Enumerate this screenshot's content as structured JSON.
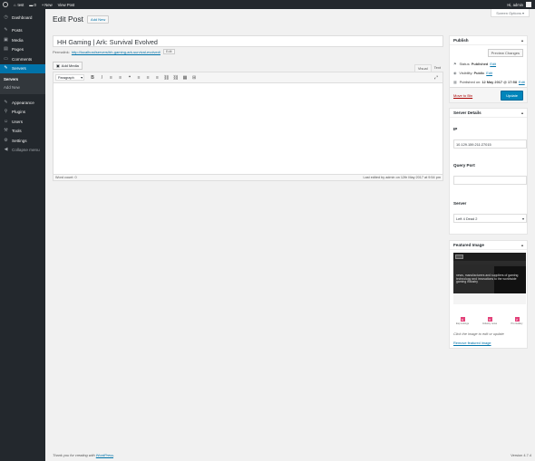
{
  "adminbar": {
    "site_name": "test",
    "comments_count": "0",
    "new_label": "New",
    "view_post_label": "View Post",
    "greeting": "Hi, admin"
  },
  "sidebar": {
    "items": [
      {
        "label": "Dashboard",
        "icon": "dashboard-icon",
        "glyph": "◷"
      },
      {
        "label": "Posts",
        "icon": "pin-icon",
        "glyph": "✎"
      },
      {
        "label": "Media",
        "icon": "media-icon",
        "glyph": "▣"
      },
      {
        "label": "Pages",
        "icon": "page-icon",
        "glyph": "▤"
      },
      {
        "label": "Comments",
        "icon": "comment-icon",
        "glyph": "▭"
      },
      {
        "label": "Servers",
        "icon": "pin-icon",
        "glyph": "✎"
      }
    ],
    "submenu": [
      {
        "label": "Servers"
      },
      {
        "label": "Add New"
      }
    ],
    "items2": [
      {
        "label": "Appearance",
        "icon": "brush-icon",
        "glyph": "✎"
      },
      {
        "label": "Plugins",
        "icon": "plugin-icon",
        "glyph": "⚲"
      },
      {
        "label": "Users",
        "icon": "user-icon",
        "glyph": "☺"
      },
      {
        "label": "Tools",
        "icon": "wrench-icon",
        "glyph": "⚒"
      },
      {
        "label": "Settings",
        "icon": "settings-icon",
        "glyph": "⚙"
      },
      {
        "label": "Collapse menu",
        "icon": "collapse-icon",
        "glyph": "◀"
      }
    ]
  },
  "header": {
    "screen_options": "Screen Options",
    "title": "Edit Post",
    "add_new": "Add New"
  },
  "post": {
    "title": "HH Gaming | Ark: Survival Evolved",
    "permalink_label": "Permalink:",
    "permalink_url": "http://localhost/servers/hh-gaming-ark-survival-evolved/",
    "edit_label": "Edit"
  },
  "editor": {
    "add_media": "Add Media",
    "tab_visual": "Visual",
    "tab_text": "Text",
    "format": "Paragraph",
    "toolbar_glyphs": [
      "B",
      "I",
      "≡",
      "≡",
      "❝",
      "≡",
      "≡",
      "≡",
      "⛓",
      "⛓",
      "▦",
      "⊞",
      "⤢"
    ],
    "toolbar_names": [
      "bold-icon",
      "italic-icon",
      "bullet-list-icon",
      "numbered-list-icon",
      "blockquote-icon",
      "align-left-icon",
      "align-center-icon",
      "align-right-icon",
      "link-icon",
      "unlink-icon",
      "read-more-icon",
      "toolbar-toggle-icon",
      "fullscreen-icon"
    ],
    "word_count": "Word count: 0",
    "last_edited": "Last edited by admin on 12th May 2017 at 9:54 pm"
  },
  "publish": {
    "title": "Publish",
    "preview": "Preview Changes",
    "status_label": "Status:",
    "status_value": "Published",
    "status_edit": "Edit",
    "visibility_label": "Visibility:",
    "visibility_value": "Public",
    "visibility_edit": "Edit",
    "published_label": "Published on:",
    "published_value": "12 May 2017 @ 17:58",
    "published_edit": "Edit",
    "trash": "Move to Bin",
    "update": "Update"
  },
  "details": {
    "title": "Server Details",
    "ip_label": "IP",
    "ip_value": "10.129.159.211:27015",
    "query_label": "Query Port",
    "query_value": "",
    "server_label": "Server",
    "server_value": "Left 4 Dead 2"
  },
  "featured": {
    "title": "Featured Image",
    "image_text": "news, manufacturers and suppliers of gaming technology and innovations to the worldwide gaming industry",
    "icons": [
      {
        "glyph": "E",
        "caption": "Esp Listings"
      },
      {
        "glyph": "O",
        "caption": "Industry news"
      },
      {
        "glyph": "Z",
        "caption": "Pro Gallery"
      }
    ],
    "hint": "Click the image to edit or update",
    "remove": "Remove featured image"
  },
  "footer": {
    "thanks_prefix": "Thank you for creating with ",
    "thanks_link": "WordPress",
    "thanks_suffix": ".",
    "version": "Version 4.7.4"
  },
  "colors": {
    "admin_dark": "#23282d",
    "accent": "#0073aa",
    "update_button": "#0085ba",
    "trash": "#a00"
  }
}
